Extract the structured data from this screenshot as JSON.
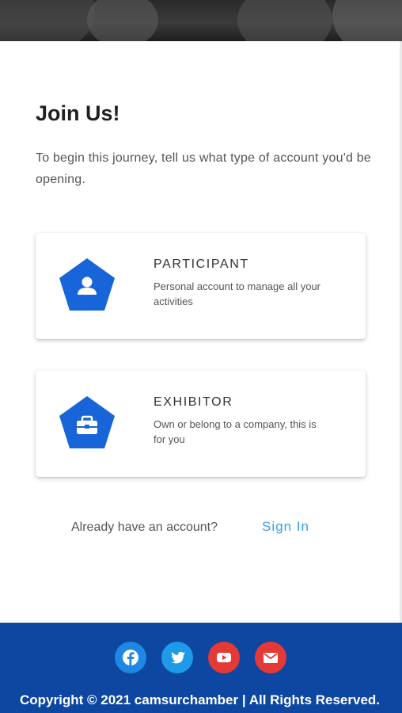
{
  "heading": {
    "title": "Join Us!",
    "subtitle": "To begin this journey, tell us what type of account you'd be opening."
  },
  "account_types": [
    {
      "title": "PARTICIPANT",
      "description": "Personal account to manage all your activities",
      "icon": "person-icon"
    },
    {
      "title": "EXHIBITOR",
      "description": "Own or belong to a company, this is for you",
      "icon": "briefcase-icon"
    }
  ],
  "signin": {
    "prompt": "Already have an account?",
    "link_label": "Sign In"
  },
  "footer": {
    "social": [
      {
        "icon": "facebook-icon",
        "color": "#1e88e5"
      },
      {
        "icon": "twitter-icon",
        "color": "#1e9be8"
      },
      {
        "icon": "youtube-icon",
        "color": "#e53935"
      },
      {
        "icon": "email-icon",
        "color": "#e53935"
      }
    ],
    "copyright": "Copyright © 2021 camsurchamber | All Rights Reserved."
  },
  "colors": {
    "accent": "#1765d8",
    "link": "#3aa0e3",
    "footer_bg": "#0d47a1"
  }
}
